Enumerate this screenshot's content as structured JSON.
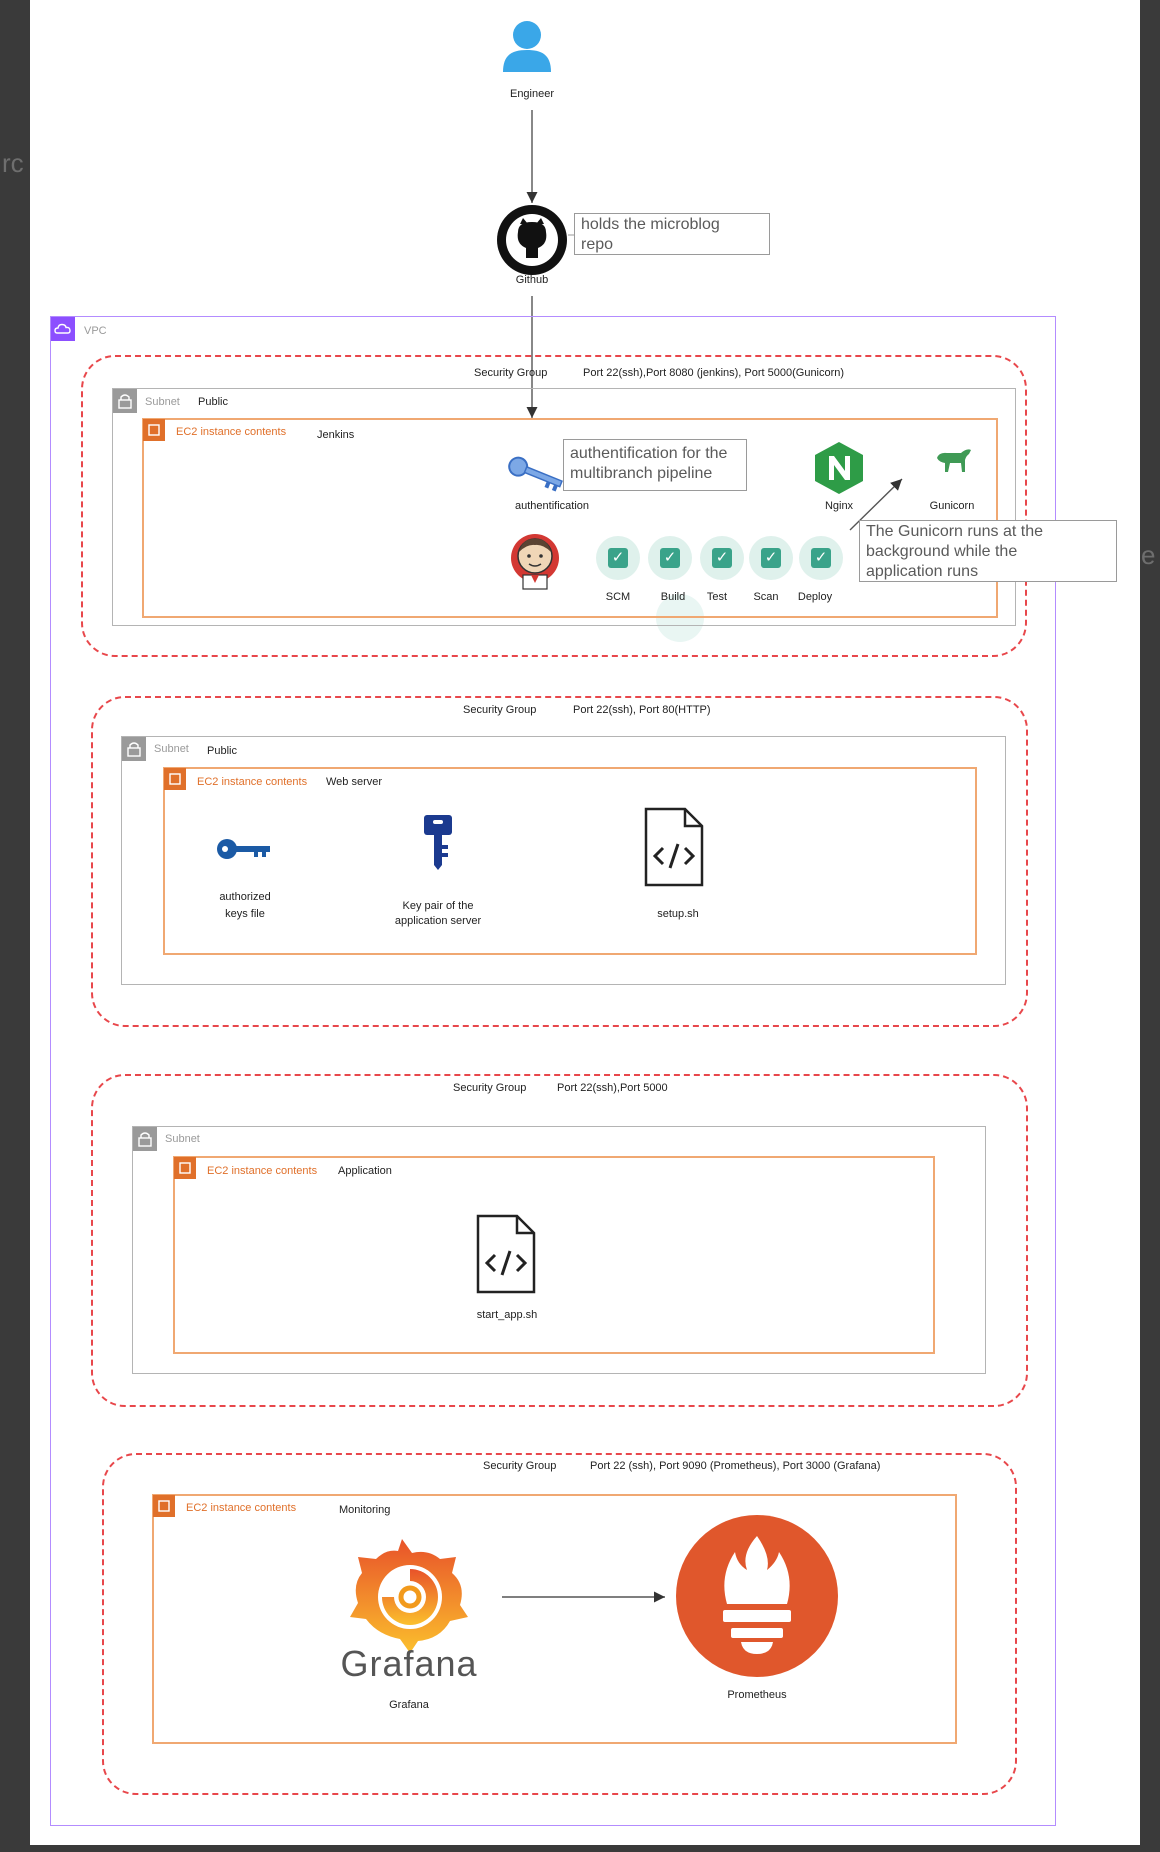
{
  "engineer": {
    "label": "Engineer"
  },
  "github": {
    "label": "Github",
    "note": [
      "holds the microblog",
      "repo"
    ]
  },
  "vpc": {
    "label": "VPC"
  },
  "jenkins_group": {
    "sg_label": "Security Group",
    "ports": "Port 22(ssh),Port 8080 (jenkins), Port 5000(Gunicorn)",
    "subnet_label": "Subnet",
    "subnet_type": "Public",
    "ec2_label": "EC2 instance contents",
    "ec2_name": "Jenkins",
    "auth_label": "authentification",
    "auth_note": [
      "authentification for the",
      "multibranch pipeline"
    ],
    "nginx_label": "Nginx",
    "gunicorn_label": "Gunicorn",
    "gunicorn_note": [
      "The Gunicorn runs at the",
      "background while the",
      "application runs"
    ],
    "stages": [
      "SCM",
      "Build",
      "Test",
      "Scan",
      "Deploy"
    ]
  },
  "web_group": {
    "sg_label": "Security Group",
    "ports": "Port 22(ssh), Port 80(HTTP)",
    "subnet_label": "Subnet",
    "subnet_type": "Public",
    "ec2_label": "EC2 instance contents",
    "ec2_name": "Web server",
    "authorized_keys": [
      "authorized",
      "keys file"
    ],
    "key_pair": [
      "Key pair of the",
      "application server"
    ],
    "setup": "setup.sh"
  },
  "app_group": {
    "sg_label": "Security Group",
    "ports": "Port 22(ssh),Port 5000",
    "subnet_label": "Subnet",
    "ec2_label": "EC2 instance contents",
    "ec2_name": "Application",
    "script": "start_app.sh"
  },
  "monitor_group": {
    "sg_label": "Security Group",
    "ports": "Port 22 (ssh), Port 9090 (Prometheus), Port 3000 (Grafana)",
    "ec2_label": "EC2 instance contents",
    "ec2_name": "Monitoring",
    "grafana_logo_text": "Grafana",
    "grafana_label": "Grafana",
    "prometheus_label": "Prometheus"
  },
  "colors": {
    "security_group": "#e8474b",
    "vpc": "#b38cff",
    "ec2": "#f0a872",
    "engineer": "#3aa7e8",
    "nginx": "#2e9c47",
    "prometheus": "#e0572c",
    "grafana": "#f29a1c"
  }
}
